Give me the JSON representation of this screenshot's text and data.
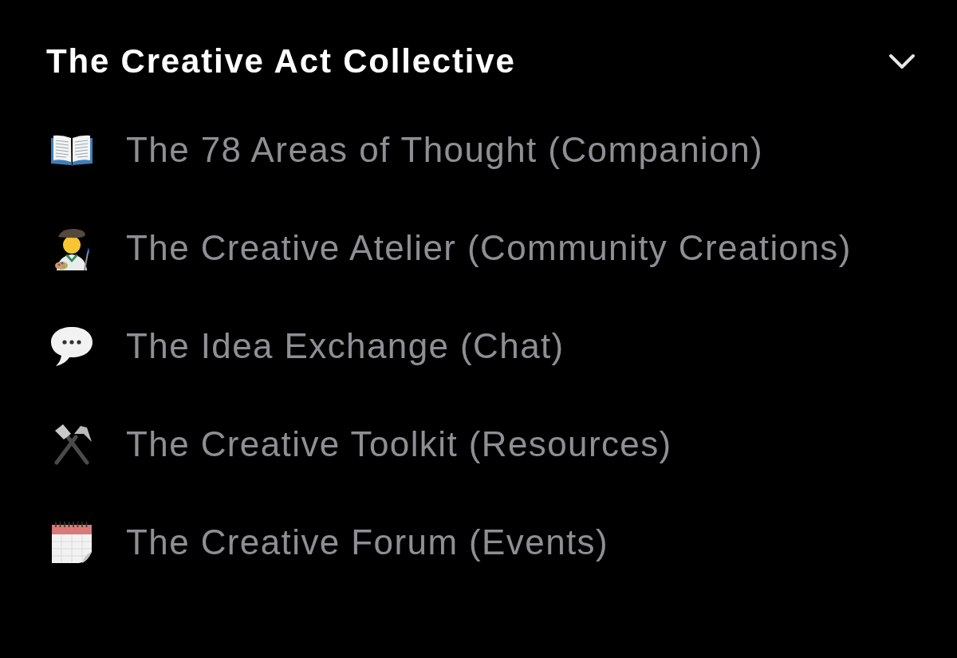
{
  "section": {
    "title": "The Creative Act Collective",
    "expanded": true
  },
  "channels": [
    {
      "kind": "book",
      "label": "The 78 Areas of Thought (Companion)"
    },
    {
      "kind": "artist",
      "label": "The Creative Atelier (Community Creations)"
    },
    {
      "kind": "speech",
      "label": "The Idea Exchange (Chat)"
    },
    {
      "kind": "tools",
      "label": "The Creative Toolkit (Resources)"
    },
    {
      "kind": "calendar",
      "label": "The Creative Forum (Events)"
    }
  ]
}
